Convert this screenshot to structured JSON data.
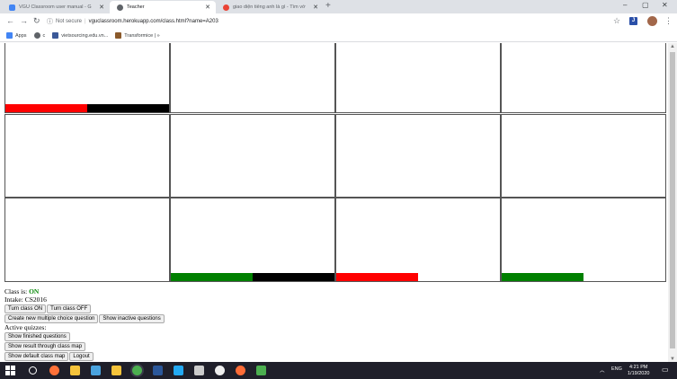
{
  "browser": {
    "tabs": [
      {
        "title": "VGU Classroom user manual - G",
        "active": false,
        "favicon_color": "#4285f4"
      },
      {
        "title": "Teacher",
        "active": true,
        "favicon_color": "#5f6368"
      },
      {
        "title": "giao diện tiếng anh là gì - Tìm vớ",
        "active": false,
        "favicon_color": "#ea4335"
      }
    ],
    "url_security": "Not secure",
    "url": "vguclassroom.herokuapp.com/class.html?name=A203",
    "extension_label": "J",
    "bookmarks": [
      {
        "label": "Apps",
        "color": "#4285f4"
      },
      {
        "label": "c",
        "color": "#5f6368"
      },
      {
        "label": "vietsourcing.edu.vn...",
        "color": "#3b5998"
      },
      {
        "label": "Transformice | »",
        "color": "#8b5a2b"
      }
    ]
  },
  "classmap": {
    "bar_colors": {
      "red": "#ff0000",
      "black": "#000000",
      "green": "#008000"
    },
    "cells": [
      {
        "row": 0,
        "col": 0,
        "bar": [
          {
            "color": "#ff0000",
            "fraction": 0.5
          },
          {
            "color": "#000000",
            "fraction": 0.5
          }
        ]
      },
      {
        "row": 0,
        "col": 1,
        "bar": []
      },
      {
        "row": 0,
        "col": 2,
        "bar": []
      },
      {
        "row": 0,
        "col": 3,
        "bar": []
      },
      {
        "row": 1,
        "col": 0,
        "bar": []
      },
      {
        "row": 1,
        "col": 1,
        "bar": []
      },
      {
        "row": 1,
        "col": 2,
        "bar": []
      },
      {
        "row": 1,
        "col": 3,
        "bar": []
      },
      {
        "row": 2,
        "col": 0,
        "bar": []
      },
      {
        "row": 2,
        "col": 1,
        "bar": [
          {
            "color": "#008000",
            "fraction": 0.5
          },
          {
            "color": "#000000",
            "fraction": 0.5
          }
        ]
      },
      {
        "row": 2,
        "col": 2,
        "bar": [
          {
            "color": "#ff0000",
            "fraction": 0.5
          }
        ]
      },
      {
        "row": 2,
        "col": 3,
        "bar": [
          {
            "color": "#008000",
            "fraction": 0.5
          }
        ]
      }
    ]
  },
  "status": {
    "class_label": "Class is:",
    "class_value": "ON",
    "intake_label": "Intake:",
    "intake_value": "CS2016",
    "active_quizzes_label": "Active quizzes:"
  },
  "buttons": {
    "turn_on": "Turn class ON",
    "turn_off": "Turn class OFF",
    "create_mcq": "Create new multiple choice question",
    "show_inactive": "Show inactive questions",
    "show_finished": "Show finished questions",
    "show_result_map": "Show result through class map",
    "show_default_map": "Show default class map",
    "logout": "Logout"
  },
  "taskbar": {
    "language": "ENG",
    "time": "4:21 PM",
    "date": "1/19/2020",
    "apps": [
      {
        "name": "search-icon",
        "color": "#ffffff"
      },
      {
        "name": "firefox-icon",
        "color": "#ff7139"
      },
      {
        "name": "file-explorer-icon",
        "color": "#f5c33b"
      },
      {
        "name": "media-icon",
        "color": "#4aa3df"
      },
      {
        "name": "store-icon",
        "color": "#f5c33b"
      },
      {
        "name": "chrome-icon",
        "color": "#4caf50"
      },
      {
        "name": "word-icon",
        "color": "#2b579a"
      },
      {
        "name": "vscode-icon",
        "color": "#23a9f2"
      },
      {
        "name": "app-icon",
        "color": "#cccccc"
      },
      {
        "name": "unity-icon",
        "color": "#eeeeee"
      },
      {
        "name": "postman-icon",
        "color": "#ff6c37"
      },
      {
        "name": "sourcetree-icon",
        "color": "#4caf50"
      }
    ]
  }
}
